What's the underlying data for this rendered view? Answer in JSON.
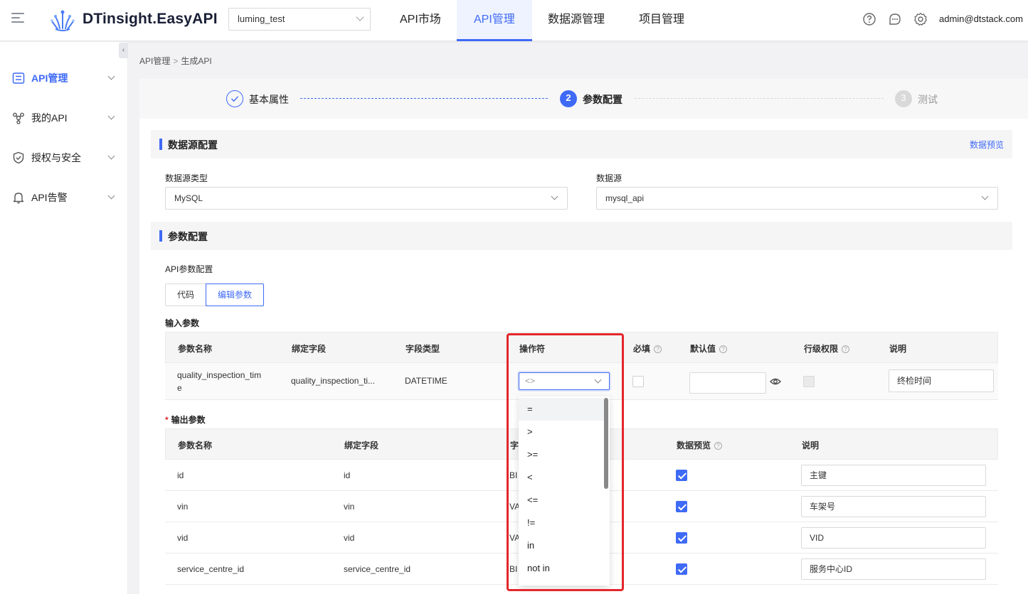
{
  "header": {
    "logo_text": "DTinsight.EasyAPI",
    "project": "luming_test",
    "nav": [
      "API市场",
      "API管理",
      "数据源管理",
      "项目管理"
    ],
    "active_nav": "API管理",
    "user": "admin@dtstack.com"
  },
  "sidebar": {
    "items": [
      {
        "label": "API管理",
        "icon": "api-list-icon",
        "active": true
      },
      {
        "label": "我的API",
        "icon": "hub-icon"
      },
      {
        "label": "授权与安全",
        "icon": "shield-check-icon"
      },
      {
        "label": "API告警",
        "icon": "bell-icon"
      }
    ]
  },
  "breadcrumb": {
    "parent": "API管理",
    "separator": ">",
    "current": "生成API"
  },
  "steps": [
    {
      "label": "基本属性",
      "status": "done"
    },
    {
      "number": "2",
      "label": "参数配置",
      "status": "active"
    },
    {
      "number": "3",
      "label": "测试",
      "status": "wait"
    }
  ],
  "datasource_section": {
    "title": "数据源配置",
    "preview_link": "数据预览",
    "type_label": "数据源类型",
    "type_value": "MySQL",
    "source_label": "数据源",
    "source_value": "mysql_api"
  },
  "param_section": {
    "title": "参数配置",
    "api_param_label": "API参数配置",
    "tabs": [
      "代码",
      "编辑参数"
    ],
    "active_tab": "编辑参数"
  },
  "input_params": {
    "title": "输入参数",
    "columns": [
      "参数名称",
      "绑定字段",
      "字段类型",
      "操作符",
      "必填",
      "默认值",
      "行级权限",
      "说明"
    ],
    "row": {
      "name_line1": "quality_inspection_tim",
      "name_line2": "e",
      "field": "quality_inspection_ti...",
      "type": "DATETIME",
      "operator_placeholder": "<>",
      "default": "",
      "desc": "终检时间"
    }
  },
  "operator_options": [
    "=",
    ">",
    ">=",
    "<",
    "<=",
    "!=",
    "in",
    "not in"
  ],
  "output_params": {
    "title": "输出参数",
    "columns": [
      "参数名称",
      "绑定字段",
      "字",
      "数据预览",
      "说明"
    ],
    "rows": [
      {
        "name": "id",
        "field": "id",
        "type": "BI",
        "preview": true,
        "desc": "主键"
      },
      {
        "name": "vin",
        "field": "vin",
        "type": "VA",
        "preview": true,
        "desc": "车架号"
      },
      {
        "name": "vid",
        "field": "vid",
        "type": "VA",
        "preview": true,
        "desc": "VID"
      },
      {
        "name": "service_centre_id",
        "field": "service_centre_id",
        "type": "BI",
        "preview": true,
        "desc": "服务中心ID"
      }
    ]
  },
  "colors": {
    "accent": "#3f6af6",
    "highlight_box": "#e3262b",
    "check": "#3f6af6"
  }
}
